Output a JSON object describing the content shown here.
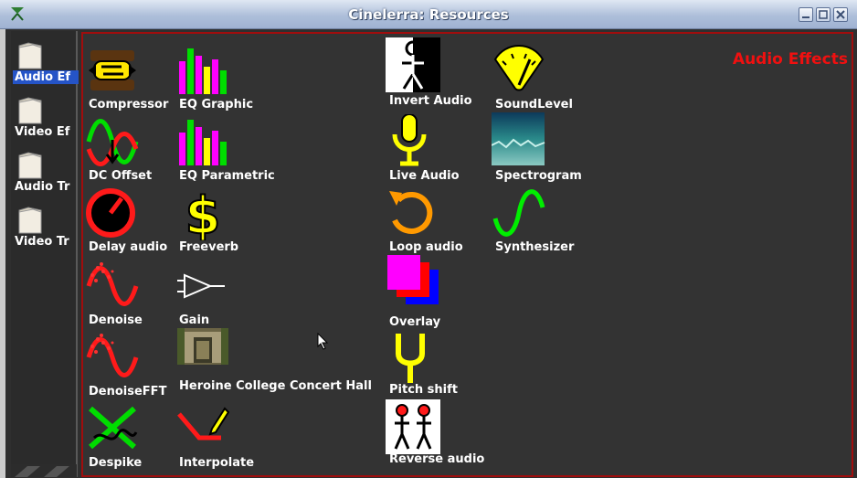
{
  "window": {
    "title": "Cinelerra: Resources"
  },
  "folders": [
    {
      "label": "Audio Ef",
      "selected": true
    },
    {
      "label": "Video Ef",
      "selected": false
    },
    {
      "label": "Audio Tr",
      "selected": false
    },
    {
      "label": "Video Tr",
      "selected": false
    }
  ],
  "content": {
    "section_title": "Audio Effects",
    "effects": [
      {
        "label": "Compressor"
      },
      {
        "label": "DC Offset"
      },
      {
        "label": "Delay audio"
      },
      {
        "label": "Denoise"
      },
      {
        "label": "DenoiseFFT"
      },
      {
        "label": "Despike"
      },
      {
        "label": "EQ Graphic"
      },
      {
        "label": "EQ Parametric"
      },
      {
        "label": "Freeverb"
      },
      {
        "label": "Gain"
      },
      {
        "label": "Heroine College Concert Hall"
      },
      {
        "label": "Interpolate"
      },
      {
        "label": "Invert Audio"
      },
      {
        "label": "Live Audio"
      },
      {
        "label": "Loop audio"
      },
      {
        "label": "Overlay"
      },
      {
        "label": "Pitch shift"
      },
      {
        "label": "Reverse audio"
      },
      {
        "label": "SoundLevel"
      },
      {
        "label": "Spectrogram"
      },
      {
        "label": "Synthesizer"
      }
    ]
  }
}
